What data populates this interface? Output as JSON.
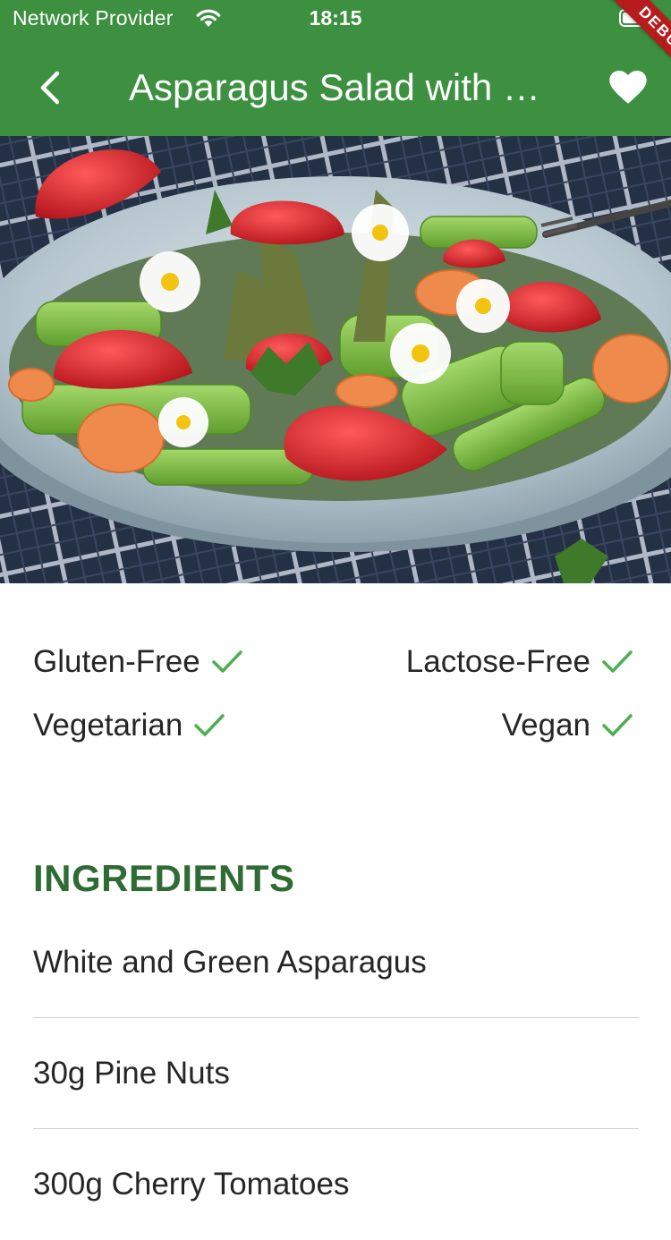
{
  "status_bar": {
    "carrier": "Network Provider",
    "time": "18:15"
  },
  "appbar": {
    "title": "Asparagus Salad with …",
    "debug_label": "DEBUG",
    "color": "#3c9040"
  },
  "hero": {
    "image_description": "bowl of asparagus salad with strawberries, carrots and daisies"
  },
  "diet": {
    "gluten_free": "Gluten-Free",
    "lactose_free": "Lactose-Free",
    "vegetarian": "Vegetarian",
    "vegan": "Vegan",
    "check_color": "#4caf50"
  },
  "ingredients": {
    "heading": "INGREDIENTS",
    "items": [
      "White and Green Asparagus",
      "30g Pine Nuts",
      "300g Cherry Tomatoes"
    ]
  }
}
